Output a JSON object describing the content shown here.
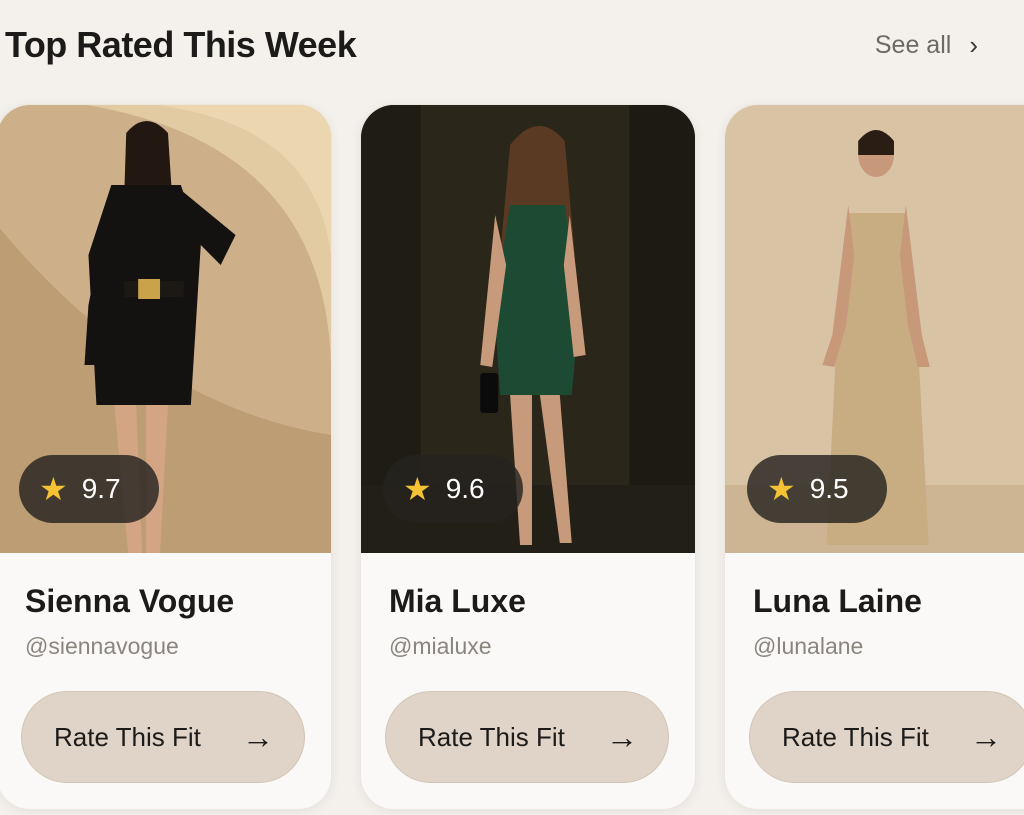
{
  "header": {
    "title": "Top Rated This Week",
    "see_all": "See all",
    "chevron": "›"
  },
  "cards": [
    {
      "name": "Sienna Vogue",
      "handle": "@siennavogue",
      "rating": "9.7",
      "button_label": "Rate This Fit",
      "arrow": "→",
      "outfit": "black blazer dress with gold belt",
      "bg_color": "#cdb08a",
      "outfit_color": "#141210"
    },
    {
      "name": "Mia Luxe",
      "handle": "@mialuxe",
      "rating": "9.6",
      "button_label": "Rate This Fit",
      "arrow": "→",
      "outfit": "green sequin mini dress",
      "bg_color": "#2a2619",
      "outfit_color": "#1d4a33"
    },
    {
      "name": "Luna Laine",
      "handle": "@lunalane",
      "rating": "9.5",
      "button_label": "Rate This Fit",
      "arrow": "→",
      "outfit": "champagne satin slip gown",
      "bg_color": "#d9c3a5",
      "outfit_color": "#c9ad82"
    }
  ],
  "icons": {
    "star": "★"
  }
}
